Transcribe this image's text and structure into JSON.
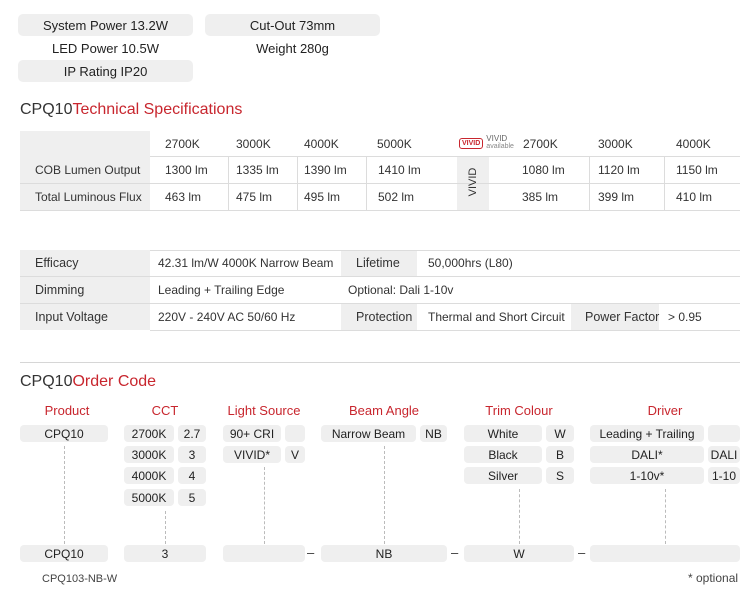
{
  "summary": {
    "system_power": "System Power  13.2W",
    "led_power": "LED Power  10.5W",
    "ip_rating": "IP Rating  IP20",
    "cut_out": "Cut-Out  73mm",
    "weight": "Weight  280g"
  },
  "tech": {
    "title_prefix": "CPQ10",
    "title_suffix": "Technical Specifications",
    "std_headers": [
      "2700K",
      "3000K",
      "4000K",
      "5000K"
    ],
    "vivid_logo": "VIVID",
    "vivid_label1": "VIVID",
    "vivid_label2": "available",
    "vivid_headers": [
      "2700K",
      "3000K",
      "4000K"
    ],
    "vivid_side": "VIVID",
    "rows": [
      {
        "label": "COB Lumen Output",
        "std": [
          "1300 lm",
          "1335 lm",
          "1390 lm",
          "1410 lm"
        ],
        "vivid": [
          "1080 lm",
          "1120 lm",
          "1150 lm"
        ]
      },
      {
        "label": "Total Luminous Flux",
        "std": [
          "463 lm",
          "475 lm",
          "495 lm",
          "502 lm"
        ],
        "vivid": [
          "385 lm",
          "399 lm",
          "410 lm"
        ]
      }
    ]
  },
  "specs": {
    "efficacy_label": "Efficacy",
    "efficacy_value": "42.31 lm/W  4000K Narrow Beam",
    "lifetime_label": "Lifetime",
    "lifetime_value": "50,000hrs (L80)",
    "dimming_label": "Dimming",
    "dimming_value": "Leading + Trailing Edge",
    "optional_value": "Optional:  Dali  1-10v",
    "voltage_label": "Input Voltage",
    "voltage_value": "220V - 240V AC  50/60 Hz",
    "protection_label": "Protection",
    "protection_value": "Thermal and Short Circuit",
    "pf_label": "Power Factor",
    "pf_value": "> 0.95"
  },
  "order": {
    "title_prefix": "CPQ10",
    "title_suffix": "Order Code",
    "headers": {
      "product": "Product",
      "cct": "CCT",
      "light_source": "Light Source",
      "beam_angle": "Beam Angle",
      "trim_colour": "Trim Colour",
      "driver": "Driver"
    },
    "product": "CPQ10",
    "cct": [
      {
        "label": "2700K",
        "code": "2.7"
      },
      {
        "label": "3000K",
        "code": "3"
      },
      {
        "label": "4000K",
        "code": "4"
      },
      {
        "label": "5000K",
        "code": "5"
      }
    ],
    "light_source": [
      {
        "label": "90+ CRI",
        "code": ""
      },
      {
        "label": "VIVID*",
        "code": "V"
      }
    ],
    "beam": [
      {
        "label": "Narrow Beam",
        "code": "NB"
      }
    ],
    "trim": [
      {
        "label": "White",
        "code": "W"
      },
      {
        "label": "Black",
        "code": "B"
      },
      {
        "label": "Silver",
        "code": "S"
      }
    ],
    "driver": [
      {
        "label": "Leading + Trailing",
        "code": ""
      },
      {
        "label": "DALI*",
        "code": "DALI"
      },
      {
        "label": "1-10v*",
        "code": "1-10"
      }
    ],
    "result": {
      "product": "CPQ10",
      "cct": "3",
      "light": "",
      "beam": "NB",
      "trim": "W",
      "driver": ""
    },
    "example": "CPQ103-NB-W",
    "optional_note": "* optional"
  },
  "colors": {
    "accent": "#c8262e",
    "panel": "#efefef"
  }
}
